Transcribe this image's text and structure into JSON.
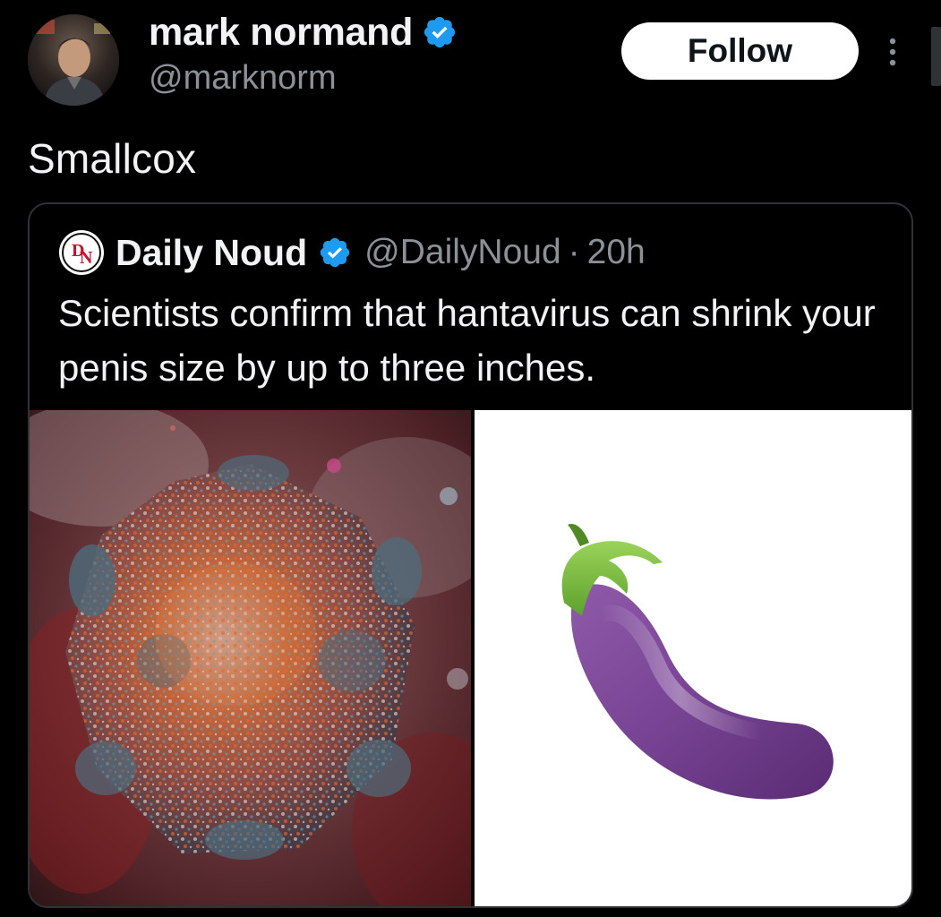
{
  "post": {
    "author_name": "mark normand",
    "author_handle": "@marknorm",
    "follow_label": "Follow",
    "text": "Smallcox"
  },
  "quoted_post": {
    "author_name": "Daily Noud",
    "author_handle": "@DailyNoud",
    "separator": "·",
    "timestamp": "20h",
    "text": "Scientists confirm that hantavirus can shrink your penis size by up to three inches.",
    "avatar_initials": "DN",
    "media": [
      "hantavirus-illustration",
      "eggplant-emoji"
    ]
  },
  "colors": {
    "background": "#000000",
    "text_primary": "#f1f3f4",
    "text_secondary": "#8b9197",
    "verified_blue": "#1d9bf0",
    "border": "#2f3336"
  }
}
